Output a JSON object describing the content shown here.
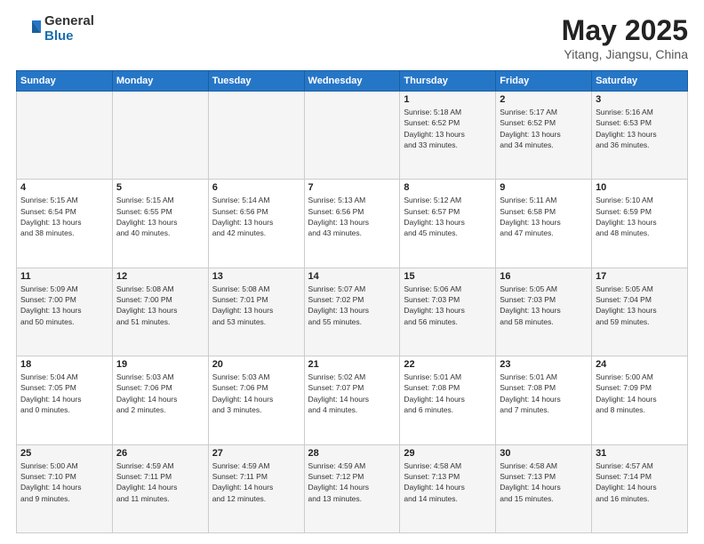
{
  "header": {
    "logo_general": "General",
    "logo_blue": "Blue",
    "title": "May 2025",
    "subtitle": "Yitang, Jiangsu, China"
  },
  "weekdays": [
    "Sunday",
    "Monday",
    "Tuesday",
    "Wednesday",
    "Thursday",
    "Friday",
    "Saturday"
  ],
  "weeks": [
    [
      {
        "day": "",
        "info": ""
      },
      {
        "day": "",
        "info": ""
      },
      {
        "day": "",
        "info": ""
      },
      {
        "day": "",
        "info": ""
      },
      {
        "day": "1",
        "info": "Sunrise: 5:18 AM\nSunset: 6:52 PM\nDaylight: 13 hours\nand 33 minutes."
      },
      {
        "day": "2",
        "info": "Sunrise: 5:17 AM\nSunset: 6:52 PM\nDaylight: 13 hours\nand 34 minutes."
      },
      {
        "day": "3",
        "info": "Sunrise: 5:16 AM\nSunset: 6:53 PM\nDaylight: 13 hours\nand 36 minutes."
      }
    ],
    [
      {
        "day": "4",
        "info": "Sunrise: 5:15 AM\nSunset: 6:54 PM\nDaylight: 13 hours\nand 38 minutes."
      },
      {
        "day": "5",
        "info": "Sunrise: 5:15 AM\nSunset: 6:55 PM\nDaylight: 13 hours\nand 40 minutes."
      },
      {
        "day": "6",
        "info": "Sunrise: 5:14 AM\nSunset: 6:56 PM\nDaylight: 13 hours\nand 42 minutes."
      },
      {
        "day": "7",
        "info": "Sunrise: 5:13 AM\nSunset: 6:56 PM\nDaylight: 13 hours\nand 43 minutes."
      },
      {
        "day": "8",
        "info": "Sunrise: 5:12 AM\nSunset: 6:57 PM\nDaylight: 13 hours\nand 45 minutes."
      },
      {
        "day": "9",
        "info": "Sunrise: 5:11 AM\nSunset: 6:58 PM\nDaylight: 13 hours\nand 47 minutes."
      },
      {
        "day": "10",
        "info": "Sunrise: 5:10 AM\nSunset: 6:59 PM\nDaylight: 13 hours\nand 48 minutes."
      }
    ],
    [
      {
        "day": "11",
        "info": "Sunrise: 5:09 AM\nSunset: 7:00 PM\nDaylight: 13 hours\nand 50 minutes."
      },
      {
        "day": "12",
        "info": "Sunrise: 5:08 AM\nSunset: 7:00 PM\nDaylight: 13 hours\nand 51 minutes."
      },
      {
        "day": "13",
        "info": "Sunrise: 5:08 AM\nSunset: 7:01 PM\nDaylight: 13 hours\nand 53 minutes."
      },
      {
        "day": "14",
        "info": "Sunrise: 5:07 AM\nSunset: 7:02 PM\nDaylight: 13 hours\nand 55 minutes."
      },
      {
        "day": "15",
        "info": "Sunrise: 5:06 AM\nSunset: 7:03 PM\nDaylight: 13 hours\nand 56 minutes."
      },
      {
        "day": "16",
        "info": "Sunrise: 5:05 AM\nSunset: 7:03 PM\nDaylight: 13 hours\nand 58 minutes."
      },
      {
        "day": "17",
        "info": "Sunrise: 5:05 AM\nSunset: 7:04 PM\nDaylight: 13 hours\nand 59 minutes."
      }
    ],
    [
      {
        "day": "18",
        "info": "Sunrise: 5:04 AM\nSunset: 7:05 PM\nDaylight: 14 hours\nand 0 minutes."
      },
      {
        "day": "19",
        "info": "Sunrise: 5:03 AM\nSunset: 7:06 PM\nDaylight: 14 hours\nand 2 minutes."
      },
      {
        "day": "20",
        "info": "Sunrise: 5:03 AM\nSunset: 7:06 PM\nDaylight: 14 hours\nand 3 minutes."
      },
      {
        "day": "21",
        "info": "Sunrise: 5:02 AM\nSunset: 7:07 PM\nDaylight: 14 hours\nand 4 minutes."
      },
      {
        "day": "22",
        "info": "Sunrise: 5:01 AM\nSunset: 7:08 PM\nDaylight: 14 hours\nand 6 minutes."
      },
      {
        "day": "23",
        "info": "Sunrise: 5:01 AM\nSunset: 7:08 PM\nDaylight: 14 hours\nand 7 minutes."
      },
      {
        "day": "24",
        "info": "Sunrise: 5:00 AM\nSunset: 7:09 PM\nDaylight: 14 hours\nand 8 minutes."
      }
    ],
    [
      {
        "day": "25",
        "info": "Sunrise: 5:00 AM\nSunset: 7:10 PM\nDaylight: 14 hours\nand 9 minutes."
      },
      {
        "day": "26",
        "info": "Sunrise: 4:59 AM\nSunset: 7:11 PM\nDaylight: 14 hours\nand 11 minutes."
      },
      {
        "day": "27",
        "info": "Sunrise: 4:59 AM\nSunset: 7:11 PM\nDaylight: 14 hours\nand 12 minutes."
      },
      {
        "day": "28",
        "info": "Sunrise: 4:59 AM\nSunset: 7:12 PM\nDaylight: 14 hours\nand 13 minutes."
      },
      {
        "day": "29",
        "info": "Sunrise: 4:58 AM\nSunset: 7:13 PM\nDaylight: 14 hours\nand 14 minutes."
      },
      {
        "day": "30",
        "info": "Sunrise: 4:58 AM\nSunset: 7:13 PM\nDaylight: 14 hours\nand 15 minutes."
      },
      {
        "day": "31",
        "info": "Sunrise: 4:57 AM\nSunset: 7:14 PM\nDaylight: 14 hours\nand 16 minutes."
      }
    ]
  ]
}
